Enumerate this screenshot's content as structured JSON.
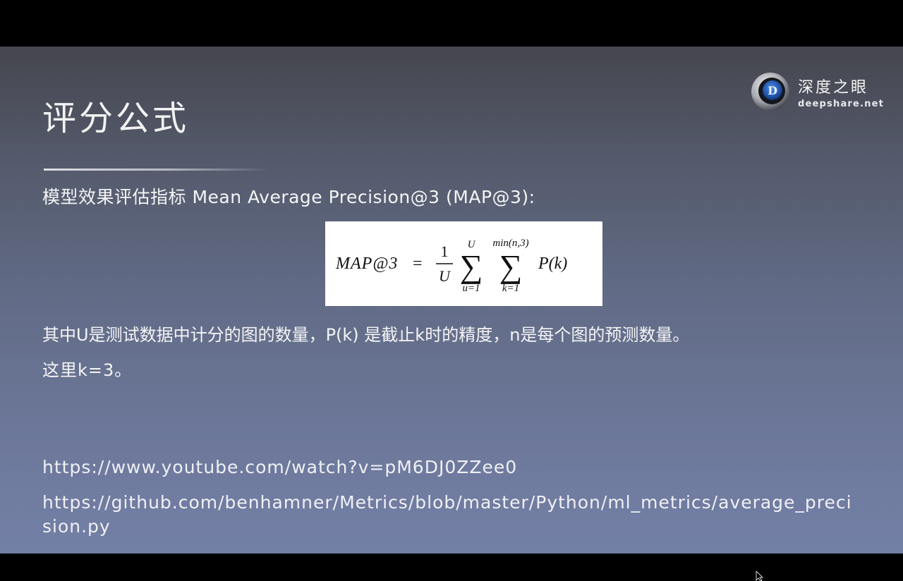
{
  "slide": {
    "title": "评分公式",
    "logo": {
      "name": "深度之眼",
      "url": "deepshare.net",
      "emblem_letter": "D",
      "icon": "deepshare-logo-icon"
    },
    "subtitle": "模型效果评估指标 Mean Average Precision@3 (MAP@3):",
    "formula": {
      "lhs": "MAP@3",
      "equals": "=",
      "frac_num": "1",
      "frac_den": "U",
      "sum1_upper": "U",
      "sum1_lower": "u=1",
      "sum2_upper": "min(n,3)",
      "sum2_lower": "k=1",
      "term": "P(k)"
    },
    "description_lines": [
      "其中U是测试数据中计分的图的数量，P(k) 是截止k时的精度，n是每个图的预测数量。",
      "这里k=3。"
    ],
    "links": [
      "https://www.youtube.com/watch?v=pM6DJ0ZZee0",
      "https://github.com/benhamner/Metrics/blob/master/Python/ml_metrics/average_precision.py"
    ]
  },
  "colors": {
    "slide_top": "#45464e",
    "slide_bottom": "#7380a6",
    "text": "#f5f5f5",
    "letterbox": "#000000"
  }
}
